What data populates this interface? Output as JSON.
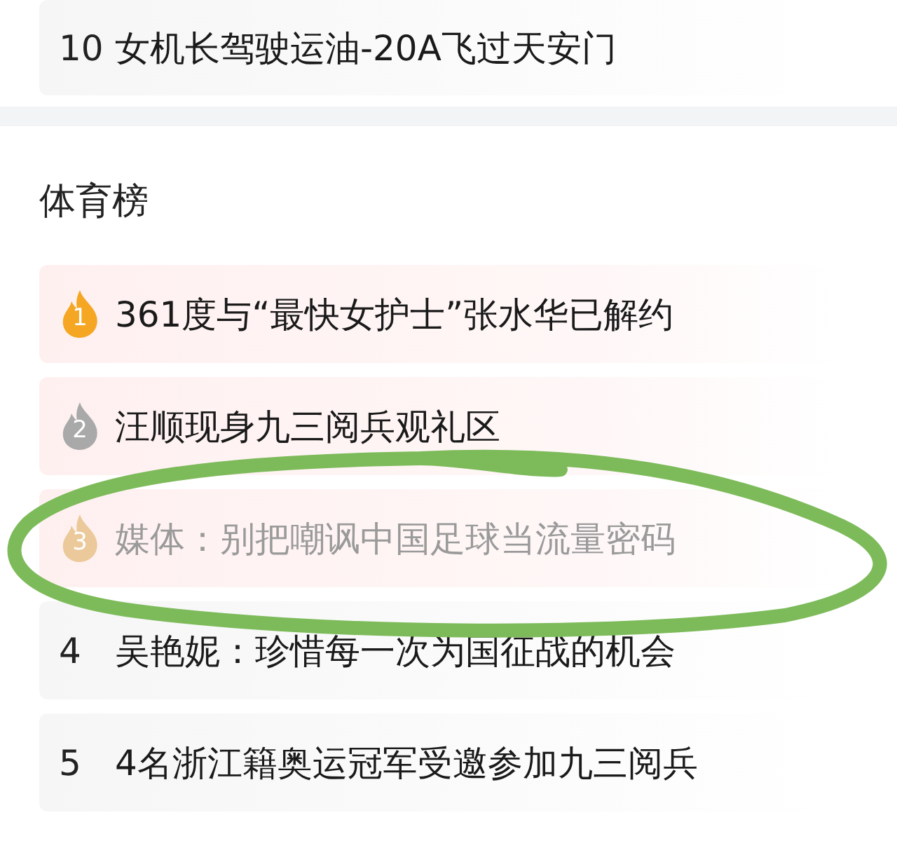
{
  "previous_list": {
    "items": [
      {
        "kind": "plain",
        "rank": "10",
        "title": "女机长驾驶运油-20A飞过天安门",
        "dimmed": false
      }
    ]
  },
  "sports_list": {
    "title": "体育榜",
    "items": [
      {
        "kind": "flame",
        "rank": "1",
        "color": "#f5a623",
        "title": "361度与“最快女护士”张水华已解约",
        "dimmed": false,
        "circled": false
      },
      {
        "kind": "flame",
        "rank": "2",
        "color": "#a9a9a9",
        "title": "汪顺现身九三阅兵观礼区",
        "dimmed": false,
        "circled": false
      },
      {
        "kind": "flame",
        "rank": "3",
        "color": "#ebc99a",
        "title": "媒体：别把嘲讽中国足球当流量密码",
        "dimmed": true,
        "circled": true
      },
      {
        "kind": "plain",
        "rank": "4",
        "title": "吴艳妮：珍惜每一次为国征战的机会",
        "dimmed": false,
        "circled": false
      },
      {
        "kind": "plain",
        "rank": "5",
        "title": "4名浙江籍奥运冠军受邀参加九三阅兵",
        "dimmed": false,
        "circled": false
      }
    ]
  }
}
